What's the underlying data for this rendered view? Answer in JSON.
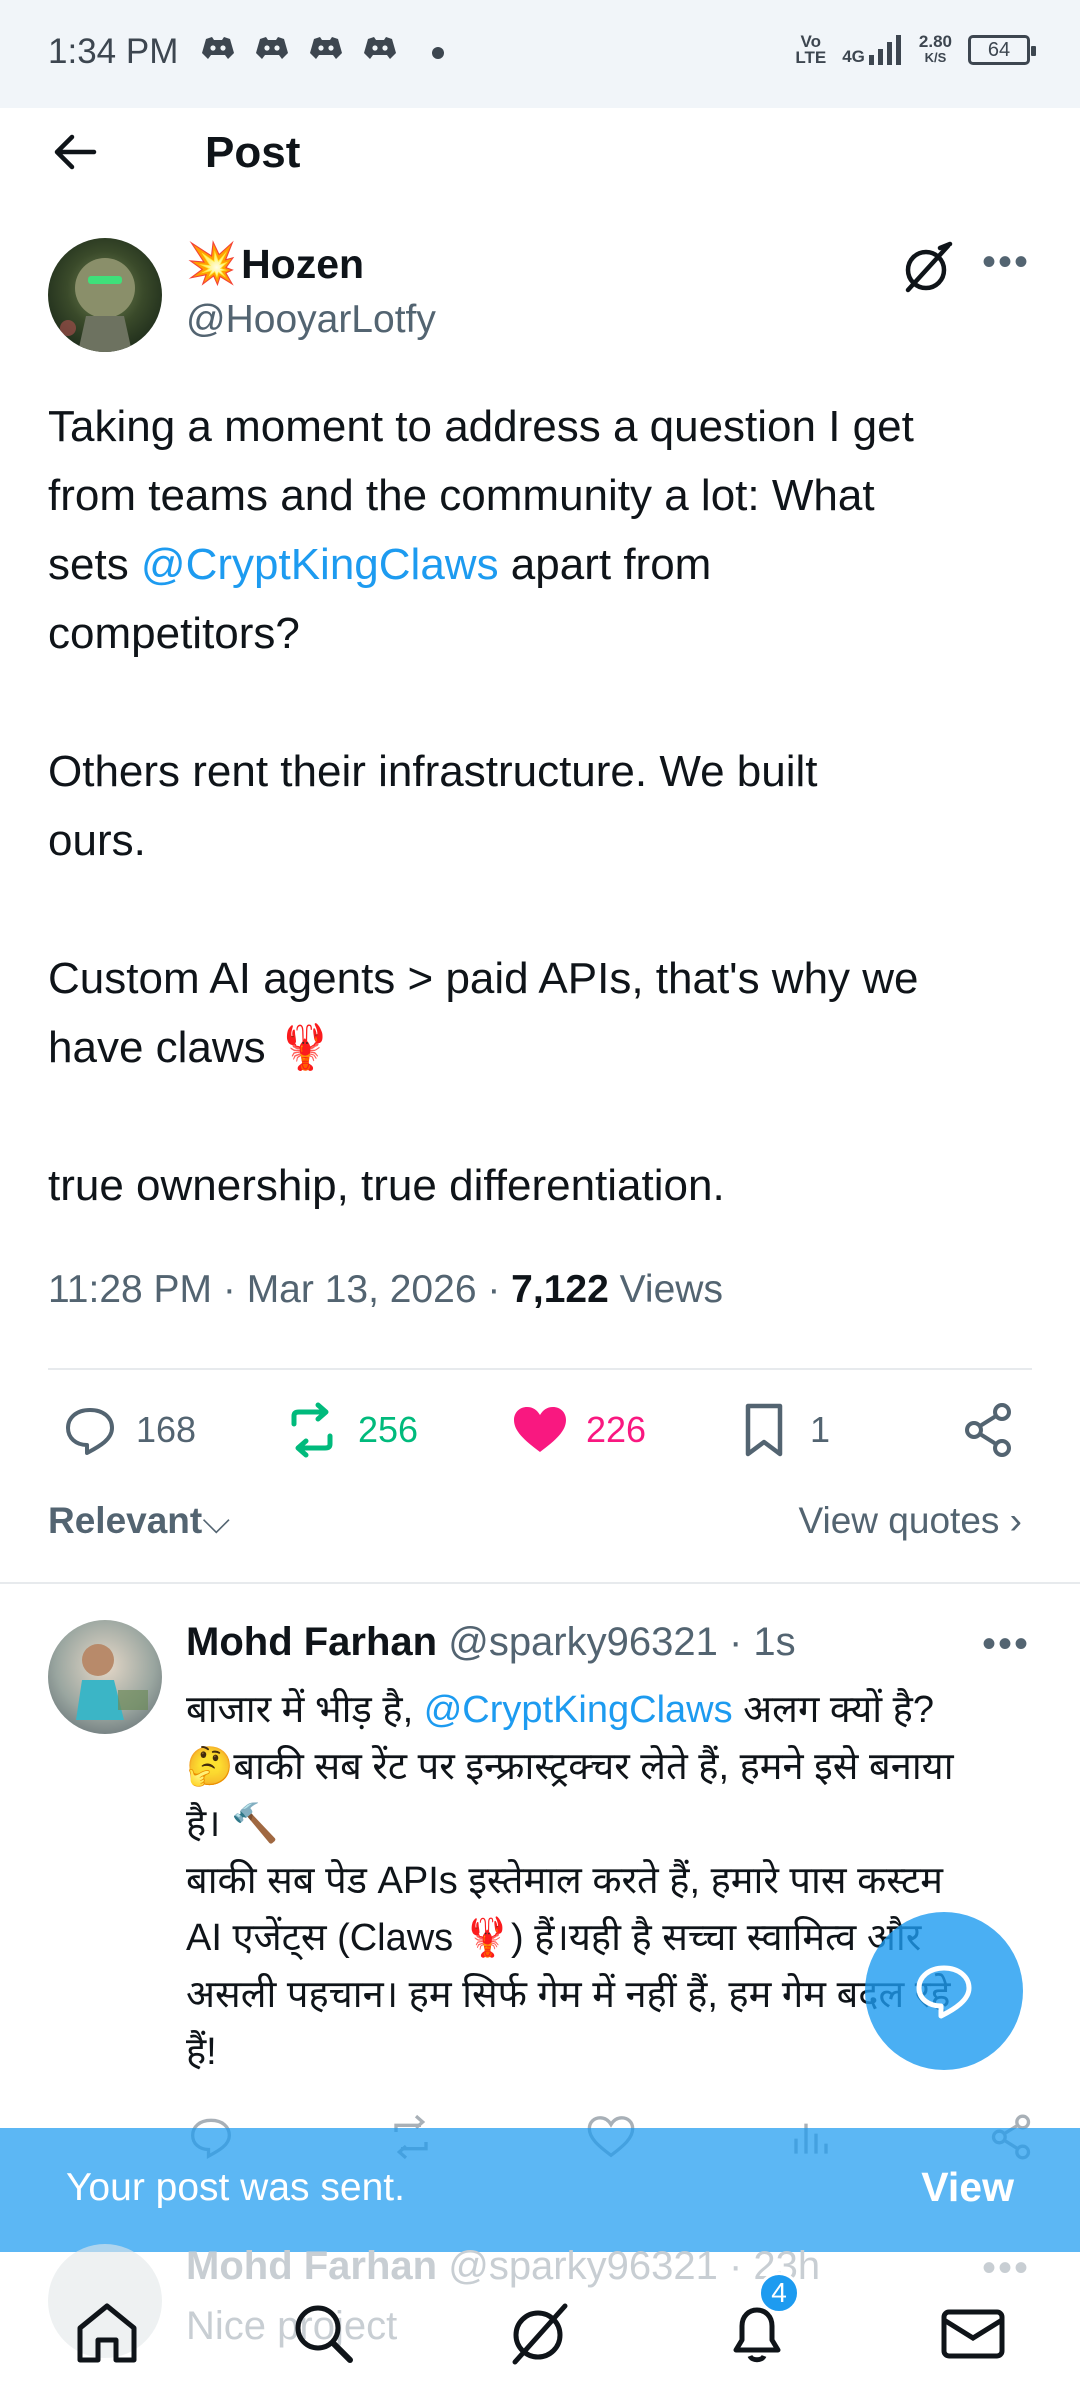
{
  "status_bar": {
    "time": "1:34 PM",
    "network_top": "Vo",
    "network_bottom": "LTE",
    "signal": "4G",
    "speed_top": "2.80",
    "speed_bottom": "K/S",
    "battery": "64"
  },
  "header": {
    "title": "Post"
  },
  "post": {
    "author_name": "Hozen",
    "author_emoji": "💥",
    "handle": "@HooyarLotfy",
    "body": {
      "p1_line1": "Taking a moment to address a question I get",
      "p1_line2": "from teams and the community a lot: What",
      "p1_line3_pre": "sets ",
      "p1_line3_mention": "@CryptKingClaws",
      "p1_line3_post": "  apart from",
      "p1_line4": "competitors?",
      "p2_line1": "Others rent their infrastructure. We built",
      "p2_line2": "ours.",
      "p3_line1": "Custom AI agents > paid APIs, that's why we",
      "p3_line2": "have claws 🦞",
      "p4_line1": "true ownership, true differentiation."
    },
    "timestamp": "11:28 PM · Mar 13, 2026 · ",
    "views_count": "7,122",
    "views_label": " Views",
    "stats": {
      "replies": "168",
      "reposts": "256",
      "likes": "226",
      "bookmarks": "1"
    },
    "colors": {
      "repost": "#00ba7c",
      "like": "#f91880",
      "link": "#1d9bf0"
    }
  },
  "sort": {
    "relevant": "Relevant",
    "view_quotes": "View quotes ›"
  },
  "reply": {
    "name": "Mohd Farhan",
    "handle": " @sparky96321 · 1s",
    "line1_pre": "बाजार में भीड़ है, ",
    "line1_mention": "@CryptKingClaws",
    "line1_post": " अलग क्यों है?",
    "line2": "🤔बाकी सब रेंट पर इन्फ्रास्ट्रक्चर लेते हैं, हमने इसे बनाया",
    "line3": "है। 🔨",
    "line4": "बाकी सब पेड APIs इस्तेमाल करते हैं, हमारे पास कस्टम",
    "line5": "AI एजेंट्स (Claws 🦞) हैं।यही है सच्चा स्वामित्व और",
    "line6": "असली पहचान। हम सिर्फ गेम में नहीं हैं, हम गेम बदल रहे",
    "line7": "हैं!"
  },
  "toast": {
    "text": "Your post was sent.",
    "action": "View"
  },
  "ghost_reply": {
    "name": "Mohd Farhan",
    "handle": " @sparky96321 · 23h",
    "body": "Nice project"
  },
  "bottom_nav": {
    "notifications_badge": "4"
  }
}
